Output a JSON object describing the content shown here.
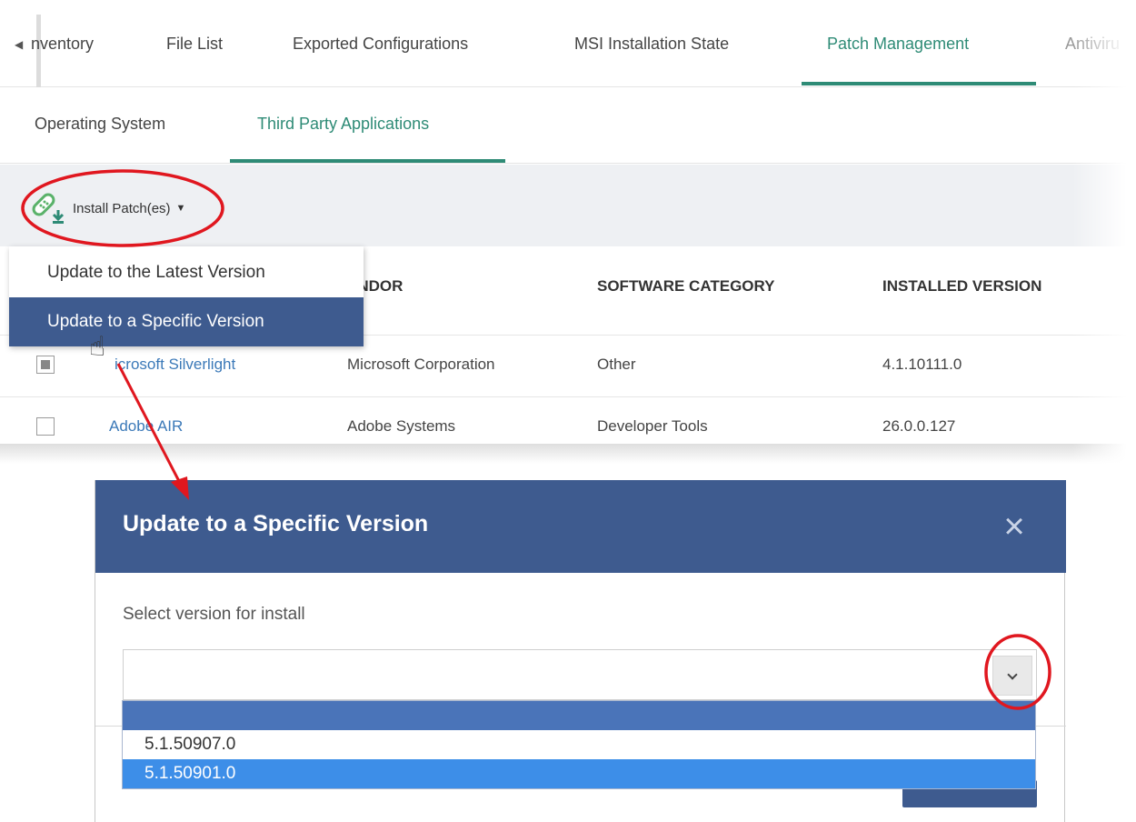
{
  "tabs": {
    "items": [
      "nventory",
      "File List",
      "Exported Configurations",
      "MSI Installation State",
      "Patch Management",
      "Antiviru"
    ],
    "active": "Patch Management"
  },
  "subtabs": {
    "items": [
      "Operating System",
      "Third Party Applications"
    ],
    "active": "Third Party Applications"
  },
  "toolbar": {
    "install_label": "Install Patch(es)",
    "install_icon": "patch-download-icon"
  },
  "install_menu": {
    "items": [
      "Update to the Latest Version",
      "Update to a Specific Version"
    ],
    "selected": "Update to a Specific Version"
  },
  "table": {
    "headers": [
      "ENDOR",
      "SOFTWARE CATEGORY",
      "INSTALLED VERSION"
    ],
    "rows": [
      {
        "name": "icrosoft Silverlight",
        "vendor": "Microsoft Corporation",
        "category": "Other",
        "version": "4.1.10111.0",
        "checked": true
      },
      {
        "name": "Adobe AIR",
        "vendor": "Adobe Systems",
        "category": "Developer Tools",
        "version": "26.0.0.127",
        "checked": false
      }
    ]
  },
  "dialog": {
    "title": "Update to a Specific Version",
    "field_label": "Select version for install",
    "selected_value": "",
    "options": [
      "",
      "5.1.50907.0",
      "5.1.50901.0"
    ],
    "highlighted_option": "5.1.50901.0"
  },
  "colors": {
    "accent_green": "#2e8b76",
    "header_blue": "#3e5b8f",
    "link_blue": "#3b79b8",
    "highlight_red": "#e0171f",
    "option_highlight": "#3d8ee8"
  }
}
